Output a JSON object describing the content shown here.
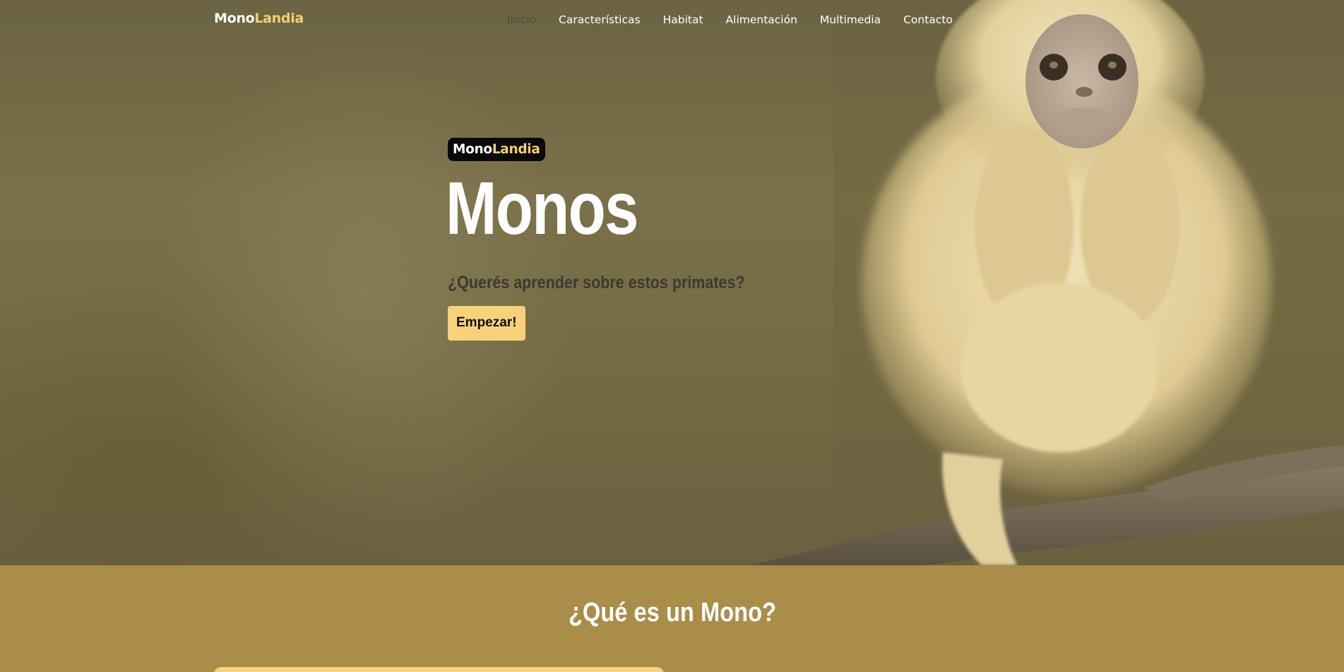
{
  "nav": {
    "brand_mono": "Mono",
    "brand_landia": "Landia",
    "links": [
      {
        "label": "Inicio",
        "active": true
      },
      {
        "label": "Características",
        "active": false
      },
      {
        "label": "Habitat",
        "active": false
      },
      {
        "label": "Alimentación",
        "active": false
      },
      {
        "label": "Multimedia",
        "active": false
      },
      {
        "label": "Contacto",
        "active": false
      }
    ]
  },
  "hero": {
    "badge_mono": "Mono",
    "badge_landia": "Landia",
    "title": "Monos",
    "subtitle": "¿Querés aprender sobre estos primates?",
    "button_label": "Empezar!",
    "image_subject": "golden snub-nosed monkey on a branch"
  },
  "section": {
    "title": "¿Qué es un Mono?"
  },
  "colors": {
    "accent": "#f7d27a",
    "section_bg": "#a98d48",
    "badge_bg": "#0a0a08"
  }
}
